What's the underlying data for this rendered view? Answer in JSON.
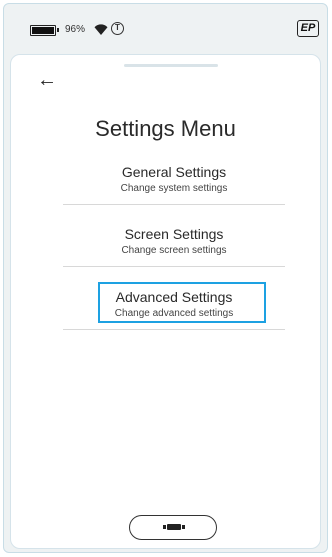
{
  "status": {
    "battery_percent": "96%",
    "battery_level": 0.96,
    "icons": [
      "battery-icon",
      "wifi-icon",
      "t-circle-icon"
    ],
    "logo_text": "EP"
  },
  "header": {
    "back_icon": "←"
  },
  "title": "Settings Menu",
  "menu": {
    "items": [
      {
        "label": "General Settings",
        "description": "Change system settings",
        "selected": false
      },
      {
        "label": "Screen Settings",
        "description": "Change screen settings",
        "selected": false
      },
      {
        "label": "Advanced Settings",
        "description": "Change advanced settings",
        "selected": true
      }
    ]
  },
  "accent_color": "#1da1e2"
}
